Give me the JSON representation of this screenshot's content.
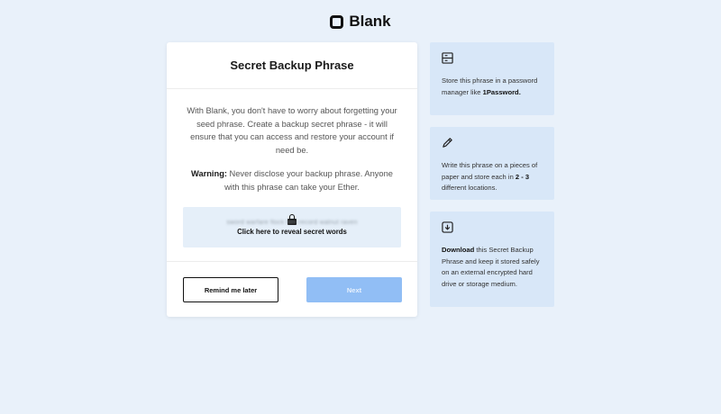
{
  "brand": {
    "name": "Blank"
  },
  "card": {
    "title": "Secret Backup Phrase",
    "description": "With Blank, you don't have to worry about forgetting your seed phrase. Create a backup secret phrase - it will ensure that you can access and restore your account if need be.",
    "warning_label": "Warning:",
    "warning_text": " Never disclose your backup phrase. Anyone with this phrase can take your Ether.",
    "blurred_phrase": "sword warfare flock film record walnut raven",
    "reveal_label": "Click here to reveal secret words",
    "remind_button": "Remind me later",
    "next_button": "Next"
  },
  "tips": [
    {
      "icon": "storage-icon",
      "text_before": "Store this phrase in a password manager like ",
      "bold": "1Password.",
      "text_after": ""
    },
    {
      "icon": "pencil-icon",
      "text_before": "Write this phrase on a pieces of paper and store each in ",
      "bold": "2 - 3",
      "text_after": " different locations."
    },
    {
      "icon": "download-icon",
      "text_before": "",
      "bold": "Download",
      "text_after": " this Secret Backup Phrase and keep it stored safely on an external encrypted hard drive or storage medium."
    }
  ],
  "colors": {
    "background": "#e9f1fa",
    "card": "#ffffff",
    "tip_background": "#d8e7f8",
    "reveal_background": "#e5eff9",
    "next_button": "#91bef5"
  }
}
